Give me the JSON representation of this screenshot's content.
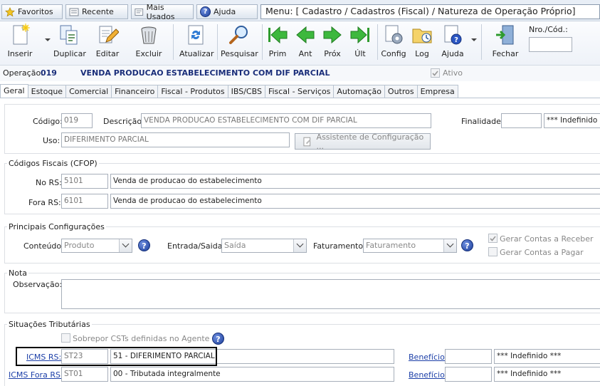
{
  "topbar": {
    "favoritos": "Favoritos",
    "recente": "Recente",
    "mais_usados": "Mais Usados",
    "ajuda": "Ajuda",
    "menu_path": "Menu: [ Cadastro / Cadastros (Fiscal) / Natureza de Operação Próprio]"
  },
  "toolbar": {
    "inserir": "Inserir",
    "duplicar": "Duplicar",
    "editar": "Editar",
    "excluir": "Excluir",
    "atualizar": "Atualizar",
    "pesquisar": "Pesquisar",
    "prim": "Prim",
    "ant": "Ant",
    "prox": "Próx",
    "ult": "Últ",
    "config": "Config",
    "log": "Log",
    "ajuda": "Ajuda",
    "fechar": "Fechar",
    "nro_cod_label": "Nro./Cód.:",
    "nro_cod_value": ""
  },
  "operation": {
    "label": "Operação:",
    "number": "019",
    "name": "VENDA PRODUCAO ESTABELECIMENTO COM DIF PARCIAL",
    "ativo_label": "Ativo",
    "ativo_checked": true
  },
  "tabs": [
    "Geral",
    "Estoque",
    "Comercial",
    "Financeiro",
    "Fiscal - Produtos",
    "IBS/CBS",
    "Fiscal - Serviços",
    "Automação",
    "Outros",
    "Empresa"
  ],
  "geral": {
    "codigo_label": "Código:",
    "codigo_value": "019",
    "descricao_label": "Descrição:",
    "descricao_value": "VENDA PRODUCAO ESTABELECIMENTO COM DIF PARCIAL",
    "finalidade_label": "Finalidade:",
    "finalidade_code": "",
    "finalidade_desc": "*** Indefinido ***",
    "uso_label": "Uso:",
    "uso_value": "DIFERIMENTO PARCIAL",
    "assistente_label": "Assistente de Configuração ..."
  },
  "cfop": {
    "title": "Códigos Fiscais (CFOP)",
    "no_rs_label": "No RS:",
    "no_rs_code": "5101",
    "no_rs_desc": "Venda de producao do estabelecimento",
    "fora_rs_label": "Fora RS:",
    "fora_rs_code": "6101",
    "fora_rs_desc": "Venda de producao do estabelecimento"
  },
  "config": {
    "title": "Principais Configurações",
    "conteudo_label": "Conteúdo:",
    "conteudo_value": "Produto",
    "entrada_saida_label": "Entrada/Saida:",
    "entrada_saida_value": "Saída",
    "faturamento_label": "Faturamento:",
    "faturamento_value": "Faturamento",
    "gerar_receber_label": "Gerar Contas a Receber",
    "gerar_receber_checked": true,
    "gerar_pagar_label": "Gerar Contas a Pagar",
    "gerar_pagar_checked": false
  },
  "nota": {
    "title": "Nota",
    "observacao_label": "Observação:",
    "observacao_value": ""
  },
  "situacoes": {
    "title": "Situações Tributárias",
    "sobrepor_label": "Sobrepor CSTs definidas no Agente",
    "icms_rs_label": "ICMS RS:",
    "icms_rs_code": "ST23",
    "icms_rs_desc": "51 - DIFERIMENTO PARCIAL",
    "icms_fora_label": "ICMS Fora RS:",
    "icms_fora_code": "ST01",
    "icms_fora_desc": "00 - Tributada integralmente",
    "beneficio_label": "Benefício:",
    "beneficio1_code": "",
    "beneficio1_desc": "*** Indefinido ***",
    "beneficio2_code": "",
    "beneficio2_desc": "*** Indefinido ***"
  },
  "colors": {
    "accent": "#1c3fa8",
    "operation_text": "#1a2e7a",
    "highlight_border": "#000000"
  }
}
